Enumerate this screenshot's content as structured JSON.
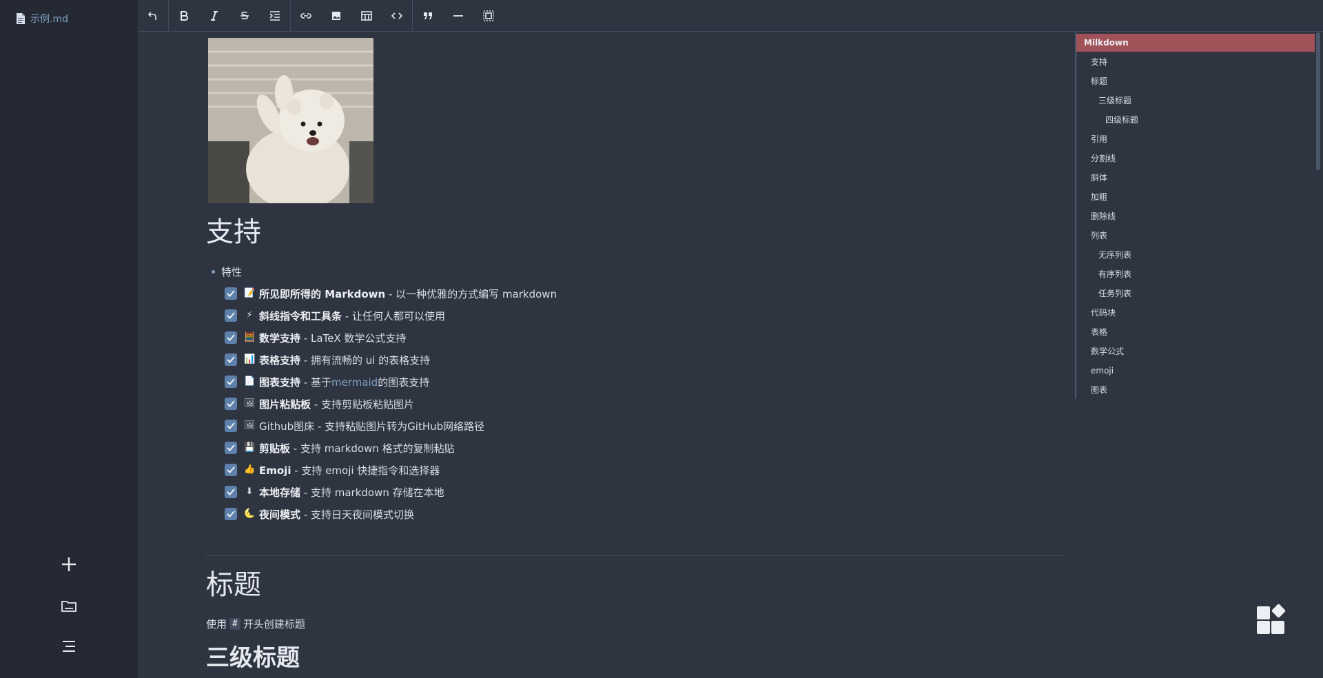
{
  "sidebar": {
    "file_name": "示例.md",
    "add_label": "+"
  },
  "toolbar": {
    "icons": [
      "undo-icon",
      "bold-icon",
      "italic-icon",
      "strikethrough-icon",
      "indent-icon",
      "link-icon",
      "image-icon",
      "table-icon",
      "code-icon",
      "quote-icon",
      "divider-icon",
      "select-all-icon"
    ]
  },
  "content": {
    "h1_support": "支持",
    "bullet": "特性",
    "tasks": [
      {
        "emoji": "📝",
        "bold": "所见即所得的 Markdown",
        "rest": " - 以一种优雅的方式编写 markdown"
      },
      {
        "emoji": "⚡",
        "bold": "斜线指令和工具条",
        "rest": " - 让任何人都可以使用"
      },
      {
        "emoji": "🧮",
        "bold": "数学支持",
        "rest": " - LaTeX 数学公式支持"
      },
      {
        "emoji": "📊",
        "bold": "表格支持",
        "rest": " - 拥有流畅的 ui 的表格支持"
      },
      {
        "emoji": "📄",
        "bold": "图表支持",
        "rest_pre": " - 基于",
        "link": "mermaid",
        "rest": "的图表支持"
      },
      {
        "emoji": "🖼",
        "bold": "图片粘贴板",
        "rest": " - 支持剪贴板粘贴图片"
      },
      {
        "emoji": "🖼",
        "bold": "",
        "plain": "Github图床",
        "rest": " - 支持粘贴图片转为GitHub网络路径"
      },
      {
        "emoji": "💾",
        "bold": "剪贴板",
        "rest": " - 支持 markdown 格式的复制粘贴"
      },
      {
        "emoji": "👍",
        "bold": "Emoji",
        "rest": " - 支持 emoji 快捷指令和选择器"
      },
      {
        "emoji": "⬇",
        "bold": "本地存储",
        "rest": " - 支持 markdown 存储在本地"
      },
      {
        "emoji": "🌜",
        "bold": "夜间模式",
        "rest": " - 支持日天夜间模式切换"
      }
    ],
    "h1_title": "标题",
    "para_pre": "使用",
    "para_code": "#",
    "para_post": "开头创建标题",
    "h3_title": "三级标题"
  },
  "outline": {
    "items": [
      {
        "label": "Milkdown",
        "level": 0,
        "active": true
      },
      {
        "label": "支持",
        "level": 1
      },
      {
        "label": "标题",
        "level": 1
      },
      {
        "label": "三级标题",
        "level": 2
      },
      {
        "label": "四级标题",
        "level": 3
      },
      {
        "label": "引用",
        "level": 1
      },
      {
        "label": "分割线",
        "level": 1
      },
      {
        "label": "斜体",
        "level": 1
      },
      {
        "label": "加粗",
        "level": 1
      },
      {
        "label": "删除线",
        "level": 1
      },
      {
        "label": "列表",
        "level": 1
      },
      {
        "label": "无序列表",
        "level": 2
      },
      {
        "label": "有序列表",
        "level": 2
      },
      {
        "label": "任务列表",
        "level": 2
      },
      {
        "label": "代码块",
        "level": 1
      },
      {
        "label": "表格",
        "level": 1
      },
      {
        "label": "数学公式",
        "level": 1
      },
      {
        "label": "emoji",
        "level": 1
      },
      {
        "label": "图表",
        "level": 1
      }
    ]
  }
}
